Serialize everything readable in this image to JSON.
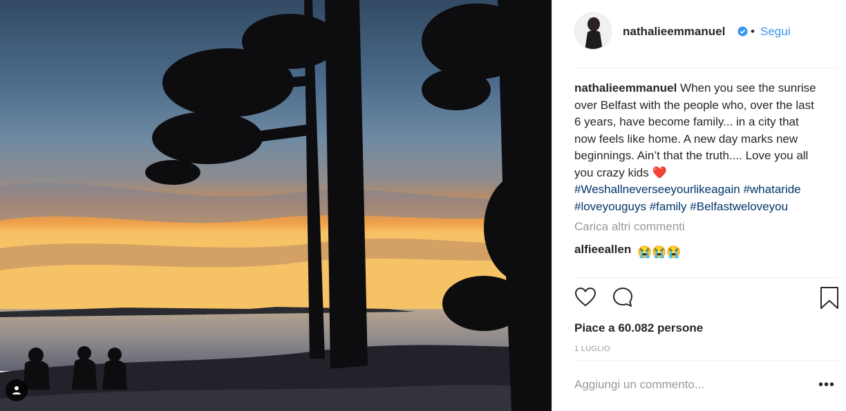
{
  "post": {
    "author": "nathalieemmanuel",
    "dot": "•",
    "follow_label": "Segui",
    "caption_user": "nathalieemmanuel",
    "caption_text": " When you see the sunrise over Belfast with the people who, over the last 6 years, have become family... in a city that now feels like home. A new day marks new beginnings. Ain’t that the truth.... Love you all you crazy kids ",
    "caption_emoji": "❤️",
    "hashtags": [
      "#Weshallneverseeyourlikeagain",
      "#whataride",
      "#loveyouguys",
      "#family",
      "#Belfastweloveyou"
    ],
    "load_more": "Carica altri commenti",
    "comment2_user": "alfieeallen",
    "comment2_emoji": "😭😭😭",
    "partial_comment": "…",
    "likes": "Piace a 60.082 persone",
    "date": "1 LUGLIO",
    "comment_placeholder": "Aggiungi un commento...",
    "more_label": "•••"
  },
  "icons": {
    "verified": "verified-badge-icon",
    "like": "heart-icon",
    "comment": "comment-bubble-icon",
    "save": "bookmark-icon",
    "tag": "user-tag-icon"
  },
  "colors": {
    "link": "#3897f0",
    "hashtag": "#003569",
    "muted": "#999999",
    "text": "#262626"
  }
}
